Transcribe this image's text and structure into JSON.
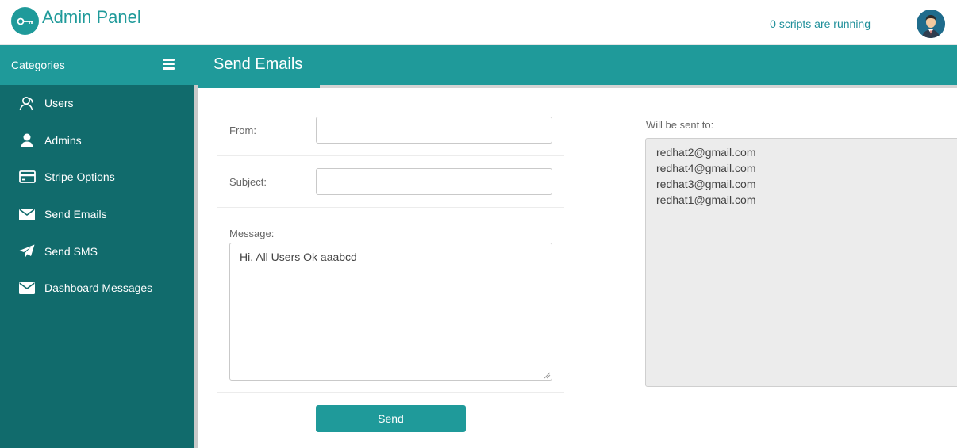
{
  "app": {
    "title": "Admin Panel",
    "scripts_status": "0 scripts are running"
  },
  "sidebar": {
    "header": "Categories",
    "items": [
      {
        "label": "Users",
        "icon": "users-icon"
      },
      {
        "label": "Admins",
        "icon": "user-icon"
      },
      {
        "label": "Stripe Options",
        "icon": "credit-card-icon"
      },
      {
        "label": "Send Emails",
        "icon": "envelope-icon"
      },
      {
        "label": "Send SMS",
        "icon": "paper-plane-icon"
      },
      {
        "label": "Dashboard Messages",
        "icon": "envelope-icon"
      }
    ]
  },
  "page": {
    "title": "Send Emails"
  },
  "form": {
    "from_label": "From:",
    "from_value": "",
    "subject_label": "Subject:",
    "subject_value": "",
    "message_label": "Message:",
    "message_value": "Hi, All Users Ok aaabcd",
    "send_label": "Send"
  },
  "recipients": {
    "label": "Will be sent to:",
    "emails": [
      "redhat2@gmail.com",
      "redhat4@gmail.com",
      "redhat3@gmail.com",
      "redhat1@gmail.com"
    ]
  },
  "colors": {
    "accent": "#1f9a9a",
    "sidebar": "#116b6c"
  }
}
